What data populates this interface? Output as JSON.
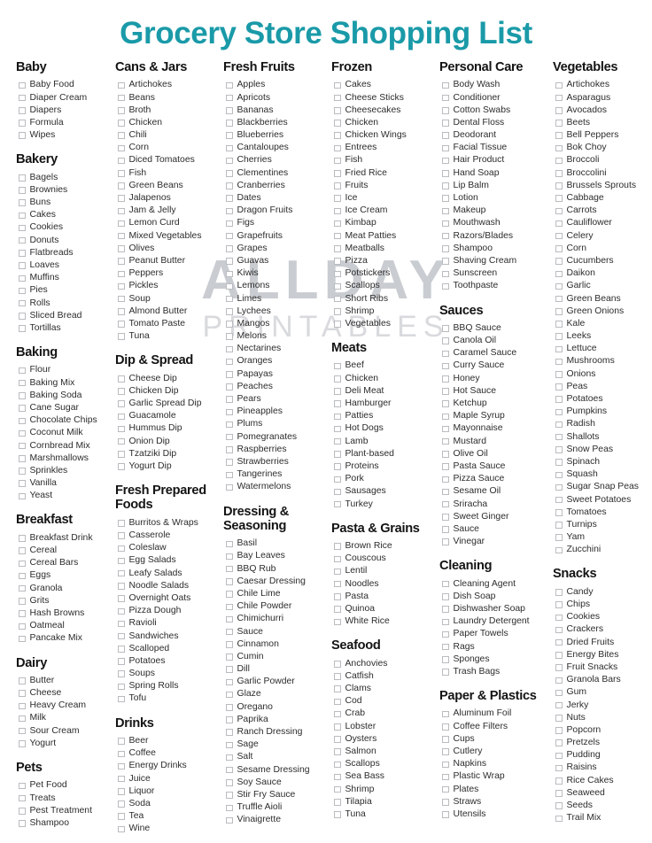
{
  "title": "Grocery Store Shopping List",
  "watermark": {
    "line1": "ALLDAY",
    "line2": "PRINTABLES"
  },
  "colors": {
    "title": "#1a9aa8",
    "heading": "#141414",
    "item": "#2c2c2c",
    "checkbox_border": "#b9bcc0",
    "watermark": "#c9ccd1"
  },
  "columns": [
    {
      "sections": [
        {
          "title": "Baby",
          "items": [
            "Baby Food",
            "Diaper Cream",
            "Diapers",
            "Formula",
            "Wipes"
          ]
        },
        {
          "title": "Bakery",
          "items": [
            "Bagels",
            "Brownies",
            "Buns",
            "Cakes",
            "Cookies",
            "Donuts",
            "Flatbreads",
            "Loaves",
            "Muffins",
            "Pies",
            "Rolls",
            "Sliced Bread",
            "Tortillas"
          ]
        },
        {
          "title": "Baking",
          "items": [
            "Flour",
            "Baking Mix",
            "Baking Soda",
            "Cane Sugar",
            "Chocolate Chips",
            "Coconut Milk",
            "Cornbread Mix",
            "Marshmallows",
            "Sprinkles",
            "Vanilla",
            "Yeast"
          ]
        },
        {
          "title": "Breakfast",
          "items": [
            "Breakfast Drink",
            "Cereal",
            "Cereal Bars",
            "Eggs",
            "Granola",
            "Grits",
            "Hash Browns",
            "Oatmeal",
            "Pancake Mix"
          ]
        },
        {
          "title": "Dairy",
          "items": [
            "Butter",
            "Cheese",
            "Heavy Cream",
            "Milk",
            "Sour Cream",
            "Yogurt"
          ]
        },
        {
          "title": "Pets",
          "items": [
            "Pet Food",
            "Treats",
            "Pest Treatment",
            "Shampoo"
          ]
        }
      ]
    },
    {
      "sections": [
        {
          "title": "Cans & Jars",
          "items": [
            "Artichokes",
            "Beans",
            "Broth",
            "Chicken",
            "Chili",
            "Corn",
            "Diced Tomatoes",
            "Fish",
            "Green Beans",
            "Jalapenos",
            "Jam & Jelly",
            "Lemon Curd",
            "Mixed Vegetables",
            "Olives",
            "Peanut Butter",
            "Peppers",
            "Pickles",
            "Soup",
            "Almond Butter",
            "Tomato Paste",
            "Tuna"
          ]
        },
        {
          "title": "Dip & Spread",
          "items": [
            "Cheese Dip",
            "Chicken Dip",
            "Garlic Spread Dip",
            "Guacamole",
            "Hummus Dip",
            "Onion Dip",
            "Tzatziki Dip",
            "Yogurt Dip"
          ]
        },
        {
          "title": "Fresh Prepared Foods",
          "items": [
            "Burritos & Wraps",
            "Casserole",
            "Coleslaw",
            "Egg Salads",
            "Leafy Salads",
            "Noodle Salads",
            "Overnight Oats",
            "Pizza Dough",
            "Ravioli",
            "Sandwiches",
            "Scalloped",
            "Potatoes",
            "Soups",
            "Spring Rolls",
            "Tofu"
          ]
        },
        {
          "title": "Drinks",
          "items": [
            "Beer",
            "Coffee",
            "Energy Drinks",
            "Juice",
            "Liquor",
            "Soda",
            "Tea",
            "Wine"
          ]
        }
      ]
    },
    {
      "sections": [
        {
          "title": "Fresh Fruits",
          "items": [
            "Apples",
            "Apricots",
            "Bananas",
            "Blackberries",
            "Blueberries",
            "Cantaloupes",
            "Cherries",
            "Clementines",
            "Cranberries",
            "Dates",
            "Dragon Fruits",
            "Figs",
            "Grapefruits",
            "Grapes",
            "Guavas",
            "Kiwis",
            "Lemons",
            "Limes",
            "Lychees",
            "Mangos",
            "Melons",
            "Nectarines",
            "Oranges",
            "Papayas",
            "Peaches",
            "Pears",
            "Pineapples",
            "Plums",
            "Pomegranates",
            "Raspberries",
            "Strawberries",
            "Tangerines",
            "Watermelons"
          ]
        },
        {
          "title": "Dressing & Seasoning",
          "items": [
            "Basil",
            "Bay Leaves",
            "BBQ Rub",
            "Caesar Dressing",
            "Chile Lime",
            "Chile Powder",
            "Chimichurri",
            "Sauce",
            "Cinnamon",
            "Cumin",
            "Dill",
            "Garlic Powder",
            "Glaze",
            "Oregano",
            "Paprika",
            "Ranch Dressing",
            "Sage",
            "Salt",
            "Sesame Dressing",
            "Soy Sauce",
            "Stir Fry Sauce",
            "Truffle Aioli",
            "Vinaigrette"
          ]
        }
      ]
    },
    {
      "sections": [
        {
          "title": "Frozen",
          "items": [
            "Cakes",
            "Cheese Sticks",
            "Cheesecakes",
            "Chicken",
            "Chicken Wings",
            "Entrees",
            "Fish",
            "Fried Rice",
            "Fruits",
            "Ice",
            "Ice Cream",
            "Kimbap",
            "Meat Patties",
            "Meatballs",
            "Pizza",
            "Potstickers",
            "Scallops",
            "Short Ribs",
            "Shrimp",
            "Vegetables"
          ]
        },
        {
          "title": "Meats",
          "items": [
            "Beef",
            "Chicken",
            "Deli Meat",
            "Hamburger",
            "Patties",
            "Hot Dogs",
            "Lamb",
            "Plant-based",
            "Proteins",
            "Pork",
            "Sausages",
            "Turkey"
          ]
        },
        {
          "title": "Pasta & Grains",
          "items": [
            "Brown Rice",
            "Couscous",
            "Lentil",
            "Noodles",
            "Pasta",
            "Quinoa",
            "White Rice"
          ]
        },
        {
          "title": "Seafood",
          "items": [
            "Anchovies",
            "Catfish",
            "Clams",
            "Cod",
            "Crab",
            "Lobster",
            "Oysters",
            "Salmon",
            "Scallops",
            "Sea Bass",
            "Shrimp",
            "Tilapia",
            "Tuna"
          ]
        }
      ]
    },
    {
      "sections": [
        {
          "title": "Personal Care",
          "items": [
            "Body Wash",
            "Conditioner",
            "Cotton Swabs",
            "Dental Floss",
            "Deodorant",
            "Facial Tissue",
            "Hair Product",
            "Hand Soap",
            "Lip Balm",
            "Lotion",
            "Makeup",
            "Mouthwash",
            "Razors/Blades",
            "Shampoo",
            "Shaving Cream",
            "Sunscreen",
            "Toothpaste"
          ]
        },
        {
          "title": "Sauces",
          "items": [
            "BBQ Sauce",
            "Canola Oil",
            "Caramel Sauce",
            "Curry Sauce",
            "Honey",
            "Hot Sauce",
            "Ketchup",
            "Maple Syrup",
            "Mayonnaise",
            "Mustard",
            "Olive Oil",
            "Pasta Sauce",
            "Pizza Sauce",
            "Sesame Oil",
            "Sriracha",
            "Sweet Ginger",
            "Sauce",
            "Vinegar"
          ]
        },
        {
          "title": "Cleaning",
          "items": [
            "Cleaning Agent",
            "Dish Soap",
            "Dishwasher Soap",
            "Laundry Detergent",
            "Paper Towels",
            "Rags",
            "Sponges",
            "Trash Bags"
          ]
        },
        {
          "title": "Paper & Plastics",
          "items": [
            "Aluminum Foil",
            "Coffee Filters",
            "Cups",
            "Cutlery",
            "Napkins",
            "Plastic Wrap",
            "Plates",
            "Straws",
            "Utensils"
          ]
        }
      ]
    },
    {
      "sections": [
        {
          "title": "Vegetables",
          "items": [
            "Artichokes",
            "Asparagus",
            "Avocados",
            "Beets",
            "Bell Peppers",
            "Bok Choy",
            "Broccoli",
            "Broccolini",
            "Brussels Sprouts",
            "Cabbage",
            "Carrots",
            "Cauliflower",
            "Celery",
            "Corn",
            "Cucumbers",
            "Daikon",
            "Garlic",
            "Green Beans",
            "Green Onions",
            "Kale",
            "Leeks",
            "Lettuce",
            "Mushrooms",
            "Onions",
            "Peas",
            "Potatoes",
            "Pumpkins",
            "Radish",
            "Shallots",
            "Snow Peas",
            "Spinach",
            "Squash",
            "Sugar Snap Peas",
            "Sweet Potatoes",
            "Tomatoes",
            "Turnips",
            "Yam",
            "Zucchini"
          ]
        },
        {
          "title": "Snacks",
          "items": [
            "Candy",
            "Chips",
            "Cookies",
            "Crackers",
            "Dried Fruits",
            "Energy Bites",
            "Fruit Snacks",
            "Granola Bars",
            "Gum",
            "Jerky",
            "Nuts",
            "Popcorn",
            "Pretzels",
            "Pudding",
            "Raisins",
            "Rice Cakes",
            "Seaweed",
            "Seeds",
            "Trail Mix"
          ]
        }
      ]
    }
  ]
}
